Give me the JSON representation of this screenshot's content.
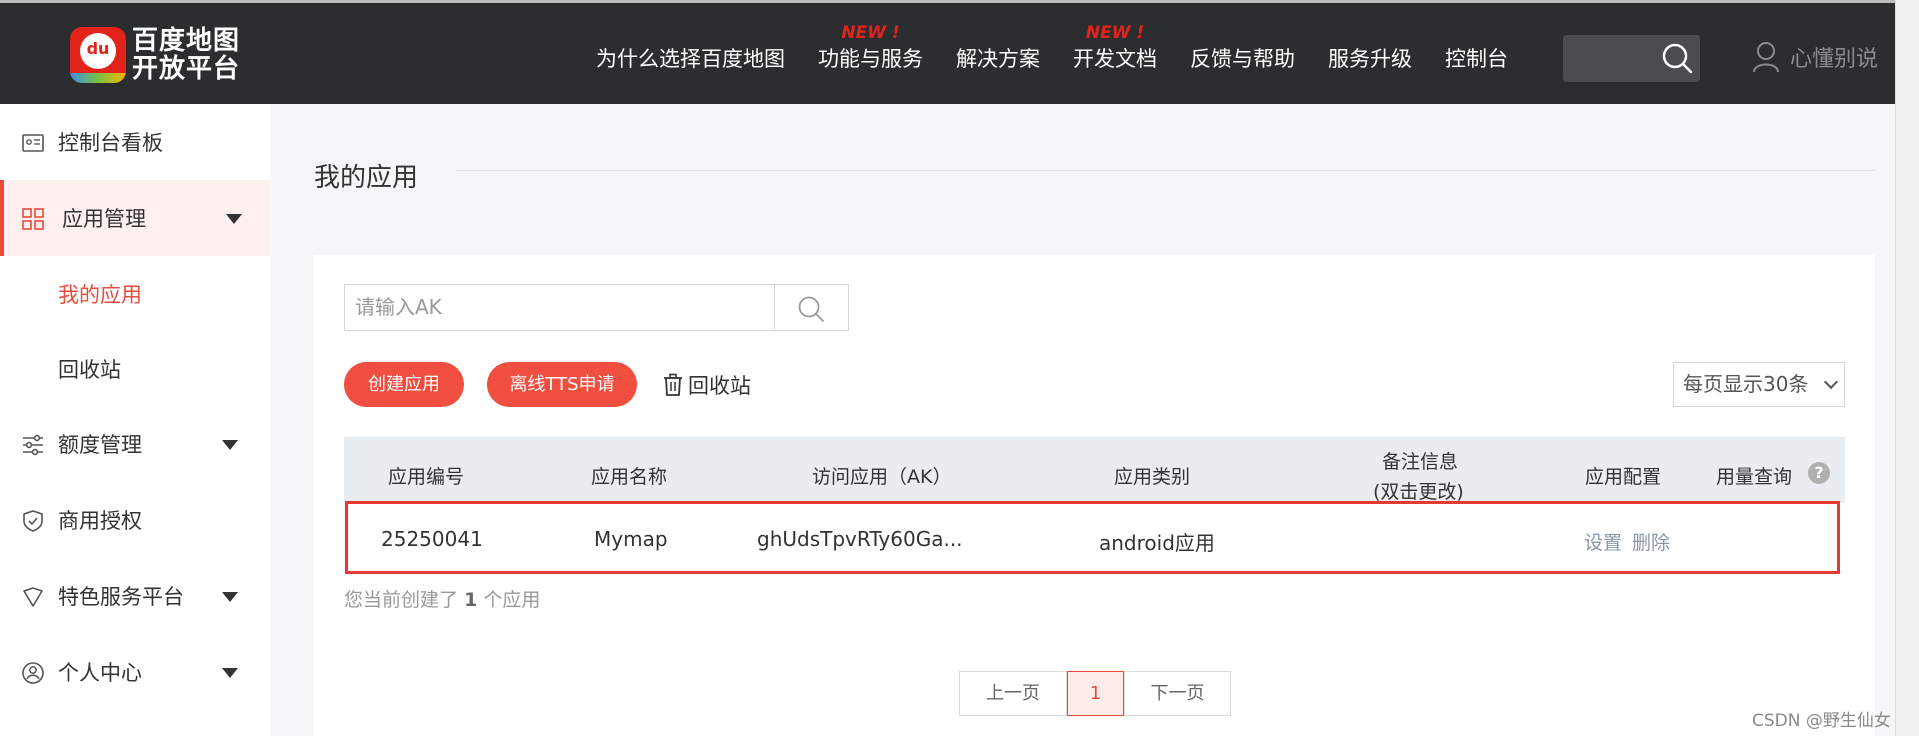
{
  "header": {
    "logo_line1": "百度地图",
    "logo_line2": "开放平台",
    "logo_mark": "du",
    "nav": [
      {
        "label": "为什么选择百度地图",
        "badge": ""
      },
      {
        "label": "功能与服务",
        "badge": "NEW !"
      },
      {
        "label": "解决方案",
        "badge": ""
      },
      {
        "label": "开发文档",
        "badge": "NEW !"
      },
      {
        "label": "反馈与帮助",
        "badge": ""
      },
      {
        "label": "服务升级",
        "badge": ""
      },
      {
        "label": "控制台",
        "badge": ""
      }
    ],
    "user_name": "心懂别说"
  },
  "sidebar": {
    "items": [
      {
        "label": "控制台看板",
        "icon": "id-card-icon"
      },
      {
        "label": "应用管理",
        "icon": "grid-icon"
      },
      {
        "label": "额度管理",
        "icon": "sliders-icon"
      },
      {
        "label": "商用授权",
        "icon": "shield-icon"
      },
      {
        "label": "特色服务平台",
        "icon": "heart-shield-icon"
      },
      {
        "label": "个人中心",
        "icon": "user-circle-icon"
      }
    ],
    "sub_items": [
      {
        "label": "我的应用"
      },
      {
        "label": "回收站"
      }
    ]
  },
  "main": {
    "title": "我的应用",
    "search_placeholder": "请输入AK",
    "create_btn": "创建应用",
    "tts_btn": "离线TTS申请",
    "recycle_link": "回收站",
    "page_size": "每页显示30条",
    "columns": [
      "应用编号",
      "应用名称",
      "访问应用（AK）",
      "应用类别",
      "备注信息",
      "(双击更改)",
      "应用配置",
      "用量查询"
    ],
    "rows": [
      {
        "id": "25250041",
        "name": "Mymap",
        "ak": "ghUdsTpvRTy60Ga...",
        "type": "android应用",
        "note": "",
        "op_settings": "设置",
        "op_delete": "删除"
      }
    ],
    "summary_prefix": "您当前创建了",
    "summary_count": "1",
    "summary_suffix": "个应用",
    "pager": {
      "prev": "上一页",
      "current": "1",
      "next": "下一页"
    }
  },
  "watermark": "CSDN @野生仙女",
  "colors": {
    "accent": "#e84c3d",
    "topbar": "#2b2d2f",
    "table_header": "#e9edf1"
  }
}
